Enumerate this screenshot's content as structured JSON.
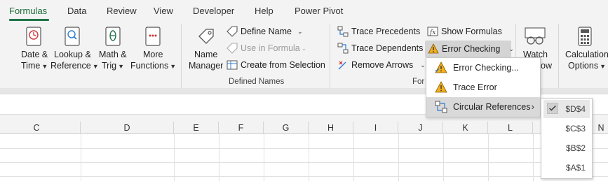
{
  "tabs": [
    {
      "label": "Formulas",
      "active": true
    },
    {
      "label": "Data"
    },
    {
      "label": "Review"
    },
    {
      "label": "View"
    },
    {
      "label": "Developer"
    },
    {
      "label": "Help"
    },
    {
      "label": "Power Pivot"
    }
  ],
  "ribbon": {
    "date_time": {
      "line1": "Date &",
      "line2": "Time"
    },
    "lookup_reference": {
      "line1": "Lookup &",
      "line2": "Reference"
    },
    "math_trig": {
      "line1": "Math &",
      "line2": "Trig"
    },
    "more_functions": {
      "line1": "More",
      "line2": "Functions"
    },
    "name_manager": {
      "line1": "Name",
      "line2": "Manager"
    },
    "define_name": "Define Name",
    "use_in_formula": "Use in Formula",
    "create_from_selection": "Create from Selection",
    "defined_names_group": "Defined Names",
    "trace_precedents": "Trace Precedents",
    "trace_dependents": "Trace Dependents",
    "remove_arrows": "Remove Arrows",
    "show_formulas": "Show Formulas",
    "error_checking": "Error Checking",
    "formula_auditing_group_partial": "For",
    "watch_window": {
      "line1": "Watch",
      "line2": "ow"
    },
    "calculation_options": {
      "line1": "Calculation",
      "line2": "Options"
    }
  },
  "error_menu": {
    "items": [
      {
        "label": "Error Checking..."
      },
      {
        "label": "Trace Error"
      },
      {
        "label": "Circular References"
      }
    ]
  },
  "circular_refs": [
    {
      "label": "$D$4",
      "checked": true
    },
    {
      "label": "$C$3",
      "checked": false
    },
    {
      "label": "$B$2",
      "checked": false
    },
    {
      "label": "$A$1",
      "checked": false
    }
  ],
  "columns": [
    "C",
    "D",
    "E",
    "F",
    "G",
    "H",
    "I",
    "J",
    "K",
    "L",
    "N"
  ],
  "colors": {
    "accent": "#217346",
    "warning": "#e8a317",
    "ribbon_bg": "#f3f3f3"
  }
}
